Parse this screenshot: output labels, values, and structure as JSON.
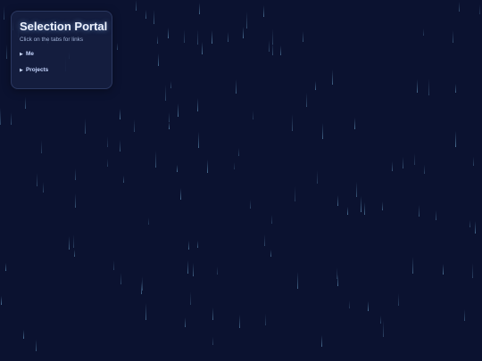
{
  "panel": {
    "title": "Selection Portal",
    "subtitle": "Click on the tabs for links",
    "items": [
      {
        "label": "Me",
        "icon": "triangle-right-icon"
      },
      {
        "label": "Projects",
        "icon": "triangle-right-icon"
      }
    ]
  },
  "colors": {
    "background": "#0b1230",
    "panel": "#162042",
    "title": "#eef3ff",
    "rain": "#78b4dc"
  }
}
